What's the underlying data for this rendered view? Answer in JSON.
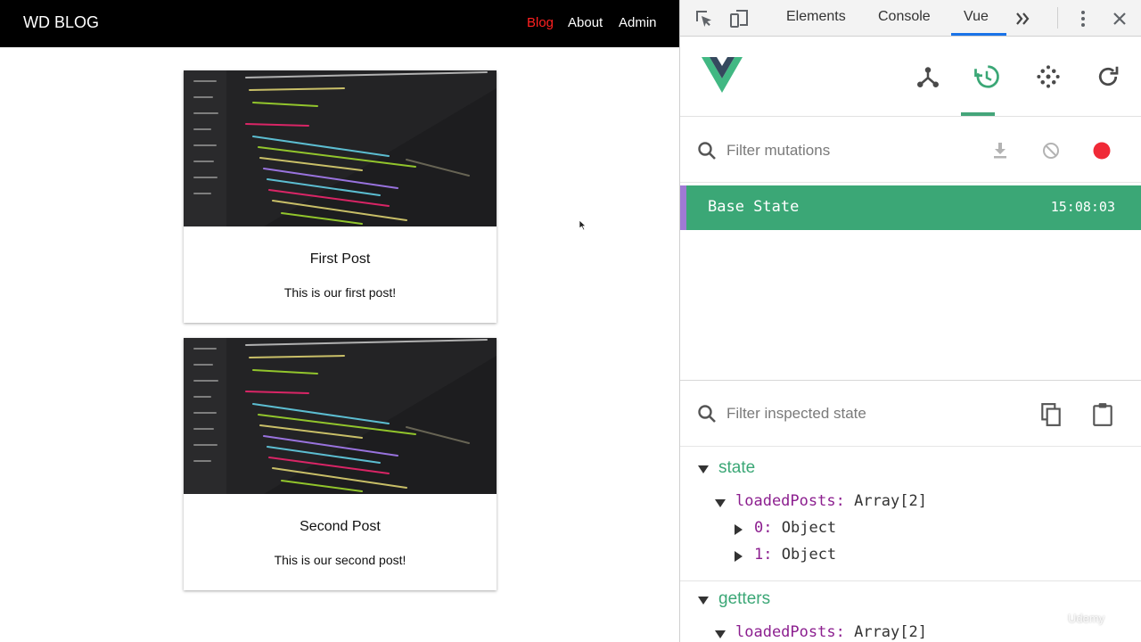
{
  "blog": {
    "brand": "WD BLOG",
    "nav": [
      {
        "label": "Blog"
      },
      {
        "label": "About"
      },
      {
        "label": "Admin"
      }
    ],
    "posts": [
      {
        "title": "First Post",
        "text": "This is our first post!"
      },
      {
        "title": "Second Post",
        "text": "This is our second post!"
      }
    ]
  },
  "devtools": {
    "tabs": [
      {
        "label": "Elements"
      },
      {
        "label": "Console"
      },
      {
        "label": "Vue"
      }
    ],
    "active_tab": "Vue",
    "vue_toolbar": {
      "buttons": [
        {
          "icon": "components-icon"
        },
        {
          "icon": "vuex-history-icon"
        },
        {
          "icon": "events-icon"
        },
        {
          "icon": "refresh-icon"
        }
      ],
      "active": "vuex-history-icon"
    },
    "mutations": {
      "filter_placeholder": "Filter mutations",
      "items": [
        {
          "name": "Base State",
          "time": "15:08:03"
        }
      ]
    },
    "state": {
      "filter_placeholder": "Filter inspected state",
      "section_state": "state",
      "section_getters": "getters",
      "state_rows": [
        {
          "key": "loadedPosts",
          "sep": ":",
          "value": "Array[2]"
        },
        {
          "key": "0",
          "sep": ":",
          "value": "Object"
        },
        {
          "key": "1",
          "sep": ":",
          "value": "Object"
        }
      ],
      "getter_rows": [
        {
          "key": "loadedPosts",
          "sep": ":",
          "value": "Array[2]"
        }
      ]
    },
    "colors": {
      "vue_green": "#3ba776",
      "record_red": "#f02a37",
      "active_tab_blue": "#1a73e8"
    }
  },
  "watermark": "Udemy"
}
